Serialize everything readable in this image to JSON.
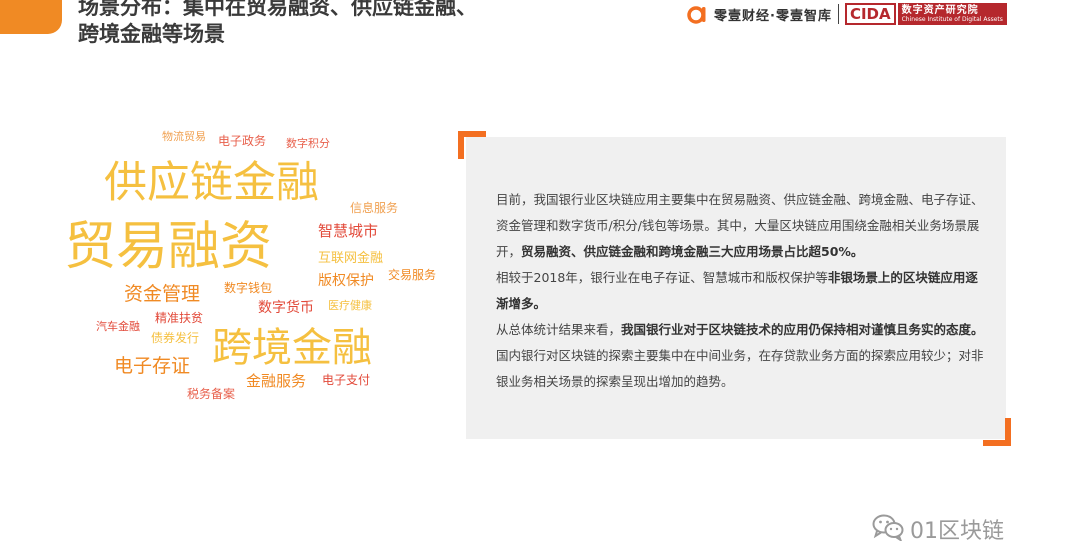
{
  "header": {
    "title_line1": "场景分布：集中在贸易融资、供应链金融、",
    "title_line2": "跨境金融等场景",
    "logo_text": "零壹财经·零壹智库",
    "cida_abbr": "CIDA",
    "cida_cn": "数字资产研究院",
    "cida_en": "Chinese Institute of Digital Assets"
  },
  "word_cloud": {
    "words": [
      {
        "text": "物流贸易"
      },
      {
        "text": "电子政务"
      },
      {
        "text": "数字积分"
      },
      {
        "text": "供应链金融"
      },
      {
        "text": "信息服务"
      },
      {
        "text": "贸易融资"
      },
      {
        "text": "智慧城市"
      },
      {
        "text": "互联网金融"
      },
      {
        "text": "资金管理"
      },
      {
        "text": "数字钱包"
      },
      {
        "text": "版权保护"
      },
      {
        "text": "交易服务"
      },
      {
        "text": "数字货币"
      },
      {
        "text": "医疗健康"
      },
      {
        "text": "精准扶贫"
      },
      {
        "text": "汽车金融"
      },
      {
        "text": "债券发行"
      },
      {
        "text": "跨境金融"
      },
      {
        "text": "电子存证"
      },
      {
        "text": "金融服务"
      },
      {
        "text": "电子支付"
      },
      {
        "text": "税务备案"
      }
    ]
  },
  "panel": {
    "p1_a": "目前，我国银行业区块链应用主要集中在贸易融资、供应链金融、跨境金融、电子存证、资金管理和数字货币/积分/钱包等场景。其中，大量区块链应用围绕金融相关业务场景展开，",
    "p1_b": "贸易融资、供应链金融和跨境金融三大应用场景占比超50%。",
    "p2_a": "相较于2018年，银行业在电子存证、智慧城市和版权保护等",
    "p2_b": "非银场景上的区块链应用逐渐增多。",
    "p3_a": "从总体统计结果来看，",
    "p3_b": "我国银行业对于区块链技术的应用仍保持相对谨慎且务实的态度。",
    "p3_c": "国内银行对区块链的探索主要集中在中间业务，在存贷款业务方面的探索应用较少；对非银业务相关场景的探索呈现出增加的趋势。"
  },
  "watermark": {
    "text": "01区块链"
  }
}
